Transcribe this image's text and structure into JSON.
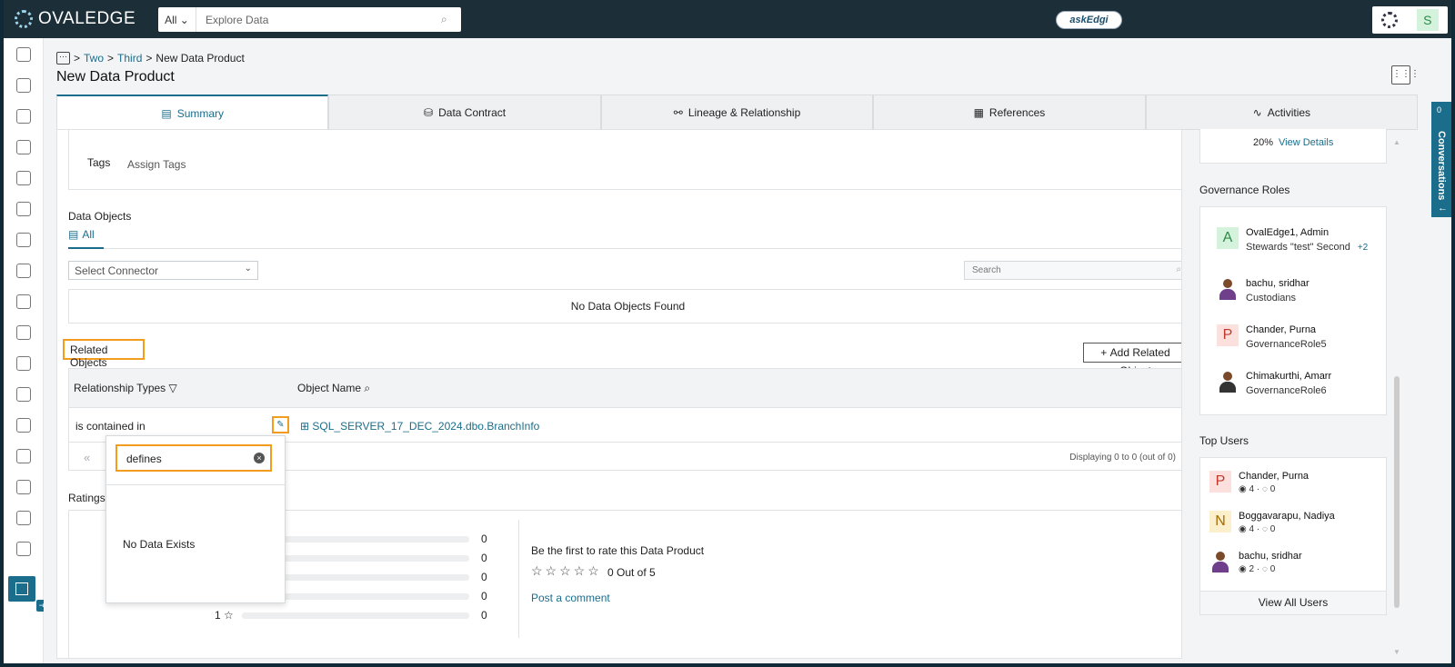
{
  "app": {
    "logo_text": "OVALEDGE",
    "askedgi_label": "askEdgi",
    "user_initial": "S"
  },
  "search": {
    "scope": "All",
    "placeholder": "Explore Data"
  },
  "breadcrumb": {
    "items": [
      "Two",
      "Third",
      "New Data Product"
    ]
  },
  "page": {
    "title": "New Data Product"
  },
  "tabs": [
    {
      "label": "Summary",
      "active": true
    },
    {
      "label": "Data Contract"
    },
    {
      "label": "Lineage & Relationship"
    },
    {
      "label": "References"
    },
    {
      "label": "Activities"
    }
  ],
  "tags": {
    "label": "Tags",
    "value": "Assign Tags"
  },
  "data_objects": {
    "title": "Data Objects",
    "filter_tab": "All",
    "connector_placeholder": "Select Connector",
    "search_placeholder": "Search",
    "empty_text": "No Data Objects Found"
  },
  "related_objects": {
    "title": "Related Objects",
    "add_button": "Add Related Object",
    "columns": [
      "Relationship Types",
      "Object Name"
    ],
    "rows": [
      {
        "relationship": "is contained in",
        "object": "SQL_SERVER_17_DEC_2024.dbo.BranchInfo"
      }
    ],
    "display_text": "Displaying 0 to 0 (out of 0)"
  },
  "dropdown": {
    "value": "defines",
    "empty_text": "No Data Exists"
  },
  "ratings": {
    "title": "Ratings",
    "counts": [
      "0",
      "0",
      "0",
      "0",
      "0"
    ],
    "star_label_last": "1",
    "first_text": "Be the first to rate this Data Product",
    "stars": "☆☆☆☆☆",
    "out_of": "0 Out of 5",
    "post_comment": "Post a comment"
  },
  "right": {
    "progress_pct": "20%",
    "view_details": "View Details",
    "governance_title": "Governance Roles",
    "roles": [
      {
        "initial": "A",
        "name": "OvalEdge1, Admin",
        "role": "Stewards \"test\" Second",
        "extra": "+2",
        "color": "#2d8a49",
        "bg": "#d5f2dc"
      },
      {
        "name": "bachu, sridhar",
        "role": "Custodians"
      },
      {
        "initial": "P",
        "name": "Chander, Purna",
        "role": "GovernanceRole5",
        "color": "#c0392b",
        "bg": "#fbe0dd"
      },
      {
        "name": "Chimakurthi, Amarr",
        "role": "GovernanceRole6"
      }
    ],
    "top_users_title": "Top Users",
    "top_users": [
      {
        "initial": "P",
        "name": "Chander, Purna",
        "views": "4",
        "comments": "0",
        "color": "#c0392b",
        "bg": "#fbe0dd"
      },
      {
        "initial": "N",
        "name": "Boggavarapu, Nadiya",
        "views": "4",
        "comments": "0",
        "color": "#a86b00",
        "bg": "#fbefcc"
      },
      {
        "name": "bachu, sridhar",
        "views": "2",
        "comments": "0"
      }
    ],
    "view_all": "View All Users"
  },
  "conversations": {
    "label": "Conversations",
    "count": "0"
  }
}
